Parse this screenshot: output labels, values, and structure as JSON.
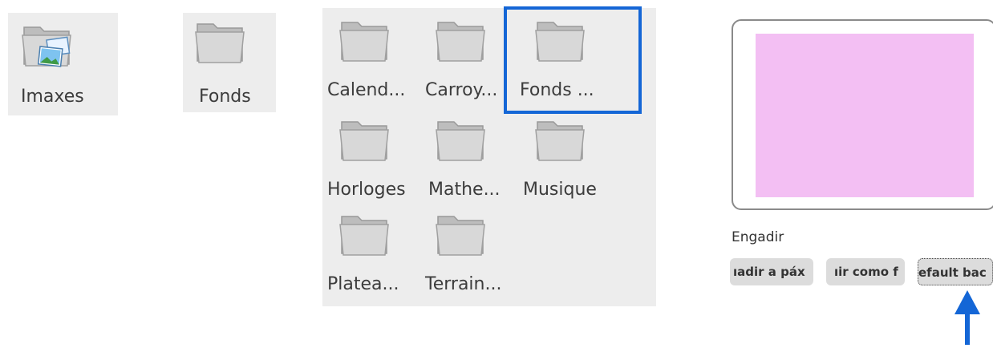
{
  "folders_left": [
    {
      "label": "Imaxes",
      "icon": "images-folder-icon"
    },
    {
      "label": "Fonds",
      "icon": "folder-icon"
    }
  ],
  "folder_grid": [
    {
      "label": "Calend...",
      "icon": "folder-icon"
    },
    {
      "label": "Carroy...",
      "icon": "folder-icon"
    },
    {
      "label": "Fonds ...",
      "icon": "folder-icon",
      "selected": true
    },
    {
      "label": "Horloges",
      "icon": "folder-icon"
    },
    {
      "label": "Mathe...",
      "icon": "folder-icon"
    },
    {
      "label": "Musique",
      "icon": "folder-icon"
    },
    {
      "label": "Platea...",
      "icon": "folder-icon"
    },
    {
      "label": "Terrain...",
      "icon": "folder-icon"
    }
  ],
  "preview": {
    "swatch_color": "#f3bff3",
    "add_label": "Engadir",
    "buttons": [
      {
        "label": "ıadir a páx"
      },
      {
        "label": "ıir como f"
      },
      {
        "label": "efault bac"
      }
    ]
  },
  "colors": {
    "selection": "#1466d6",
    "arrow": "#1466d6",
    "panel_bg": "#ededed"
  }
}
